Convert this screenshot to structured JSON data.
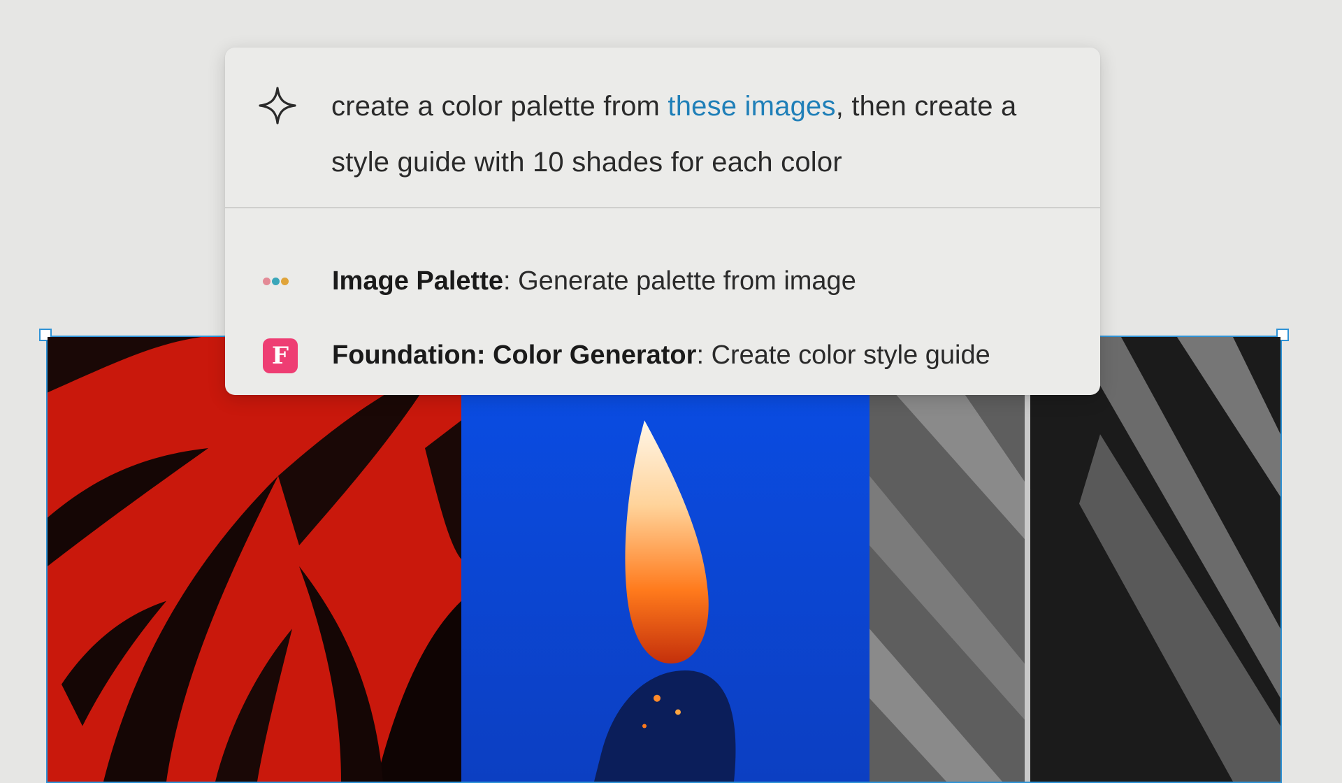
{
  "command": {
    "prompt_before_link": "create a color palette from ",
    "prompt_link": "these images",
    "prompt_after_link": ", then create a style guide with 10 shades for each color",
    "icon": "sparkle-icon",
    "link_color": "#1f7fb8"
  },
  "suggestions": [
    {
      "title": "Image Palette",
      "separator": ": ",
      "description": "Generate palette from image",
      "icon": "three-dots-palette-icon",
      "icon_colors": [
        "#e38a96",
        "#3aa6b9",
        "#e0a43a"
      ]
    },
    {
      "title": "Foundation: Color Generator",
      "separator": ": ",
      "description": "Create color style guide",
      "icon": "foundation-f-icon",
      "icon_letter": "F",
      "icon_color": "#ee3d73"
    }
  ],
  "canvas": {
    "selection_color": "#2f93d6",
    "images": [
      {
        "name": "red-leaves-image",
        "color": "#c9180c"
      },
      {
        "name": "blue-flame-image",
        "color": "#0a4fe0"
      },
      {
        "name": "gray-shadows-image",
        "color": "#1c1c1c"
      }
    ]
  }
}
